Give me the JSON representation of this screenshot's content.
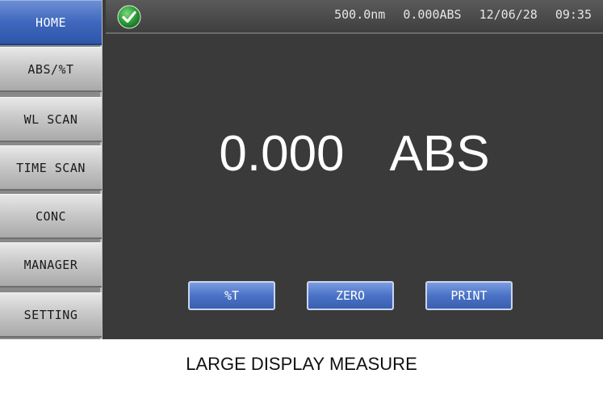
{
  "sidebar": {
    "items": [
      {
        "label": "HOME",
        "active": true
      },
      {
        "label": "ABS/%T",
        "active": false
      },
      {
        "label": "WL SCAN",
        "active": false
      },
      {
        "label": "TIME SCAN",
        "active": false
      },
      {
        "label": "CONC",
        "active": false
      },
      {
        "label": "MANAGER",
        "active": false
      },
      {
        "label": "SETTING",
        "active": false
      }
    ]
  },
  "status_bar": {
    "status_icon": "check-icon",
    "wavelength": "500.0nm",
    "absorbance": "0.000ABS",
    "date": "12/06/28",
    "time": "09:35"
  },
  "readout": {
    "value": "0.000",
    "unit": "ABS"
  },
  "actions": {
    "percent_t": "%T",
    "zero": "ZERO",
    "print": "PRINT"
  },
  "caption": "LARGE DISPLAY MEASURE",
  "colors": {
    "screen_bg": "#3a3a3a",
    "accent_blue": "#4a72c6",
    "status_green": "#2e9e3a"
  }
}
